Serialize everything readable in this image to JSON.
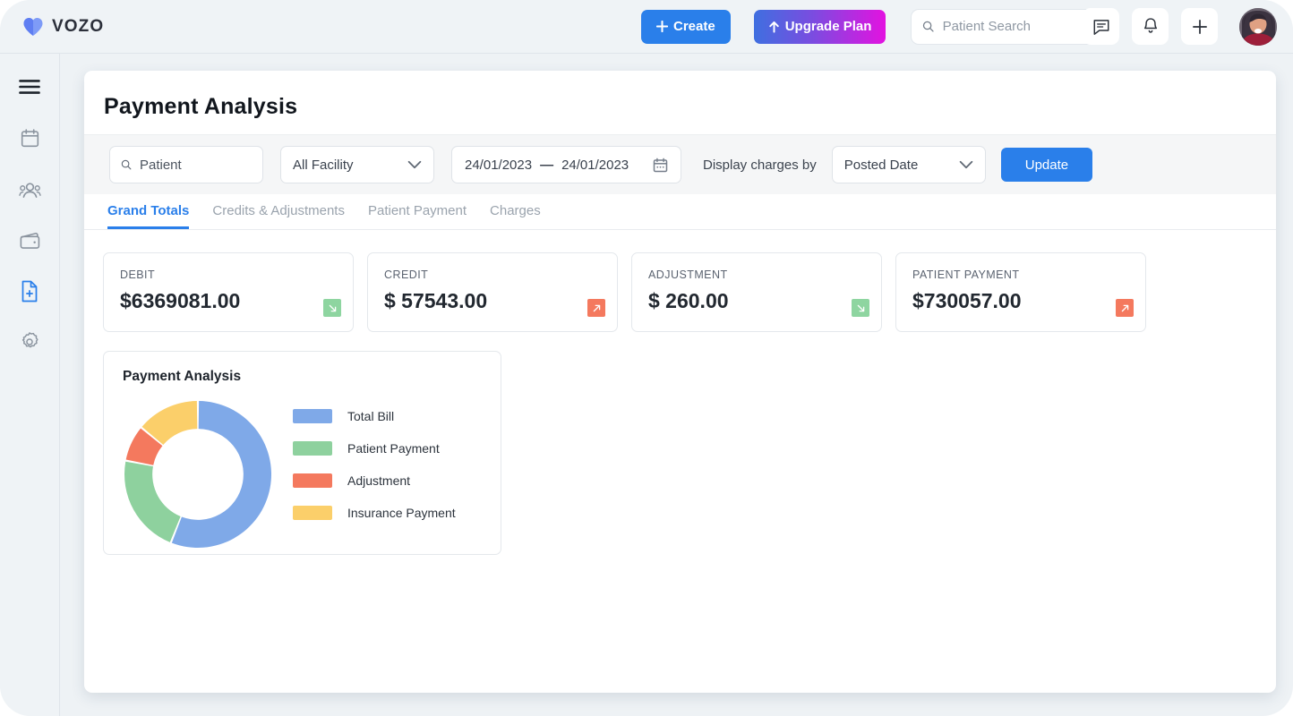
{
  "brand": {
    "name": "VOZO",
    "logo_icon": "heart-icon",
    "color": "#6e8cf5"
  },
  "topbar": {
    "create_label": "Create",
    "create_icon": "plus-icon",
    "create_color": "#2a7fea",
    "upgrade_label": "Upgrade Plan",
    "upgrade_icon": "arrow-up-icon",
    "upgrade_gradient_from": "#3f6fe0",
    "upgrade_gradient_to": "#e312e0",
    "search": {
      "value": "",
      "placeholder": "Patient Search",
      "icon": "search-icon"
    },
    "icons": [
      {
        "name": "chat-icon"
      },
      {
        "name": "bell-icon"
      },
      {
        "name": "plus-icon"
      }
    ],
    "avatar": {
      "name": "user-avatar"
    }
  },
  "sidebar": {
    "items": [
      {
        "icon": "hamburger-menu-icon",
        "active": false
      },
      {
        "icon": "calendar-icon",
        "active": false
      },
      {
        "icon": "people-group-icon",
        "active": false
      },
      {
        "icon": "wallet-icon",
        "active": false
      },
      {
        "icon": "file-plus-icon",
        "active": true
      },
      {
        "icon": "gear-icon",
        "active": false
      }
    ],
    "active_color": "#2a7fea"
  },
  "page": {
    "title": "Payment  Analysis"
  },
  "filters": {
    "patient": {
      "value": "",
      "placeholder": "Patient",
      "icon": "search-icon"
    },
    "facility": {
      "value": "All Facility",
      "icon": "chevron-down-icon"
    },
    "date_range": {
      "start": "24/01/2023",
      "separator": "—",
      "end": "24/01/2023",
      "icon": "calendar-icon"
    },
    "display_charges_label": "Display charges by",
    "charges_by": {
      "value": "Posted Date",
      "icon": "chevron-down-icon"
    },
    "update_label": "Update"
  },
  "tabs": [
    {
      "label": "Grand Totals",
      "active": true
    },
    {
      "label": "Credits & Adjustments",
      "active": false
    },
    {
      "label": "Patient Payment",
      "active": false
    },
    {
      "label": "Charges",
      "active": false
    }
  ],
  "stats": [
    {
      "label": "DEBIT",
      "value": "$6369081.00",
      "trend": "down",
      "badge_color": "#8ed5a0",
      "badge_icon": "arrow-down-right-icon"
    },
    {
      "label": "CREDIT",
      "value": "$ 57543.00",
      "trend": "up",
      "badge_color": "#f4795e",
      "badge_icon": "arrow-up-right-icon"
    },
    {
      "label": "ADJUSTMENT",
      "value": "$ 260.00",
      "trend": "down",
      "badge_color": "#8ed5a0",
      "badge_icon": "arrow-down-right-icon"
    },
    {
      "label": "PATIENT PAYMENT",
      "value": "$730057.00",
      "trend": "up",
      "badge_color": "#f4795e",
      "badge_icon": "arrow-up-right-icon"
    }
  ],
  "chart_data": {
    "type": "pie",
    "variant": "donut",
    "title": "Payment Analysis",
    "categories": [
      "Total Bill",
      "Patient Payment",
      "Adjustment",
      "Insurance Payment"
    ],
    "values": [
      56,
      22,
      8,
      14
    ],
    "colors": [
      "#7fa9e8",
      "#8ed19e",
      "#f4795e",
      "#fbcf6a"
    ],
    "legend_position": "right",
    "grid": false,
    "start_angle": 0,
    "hole_ratio": 0.62
  }
}
